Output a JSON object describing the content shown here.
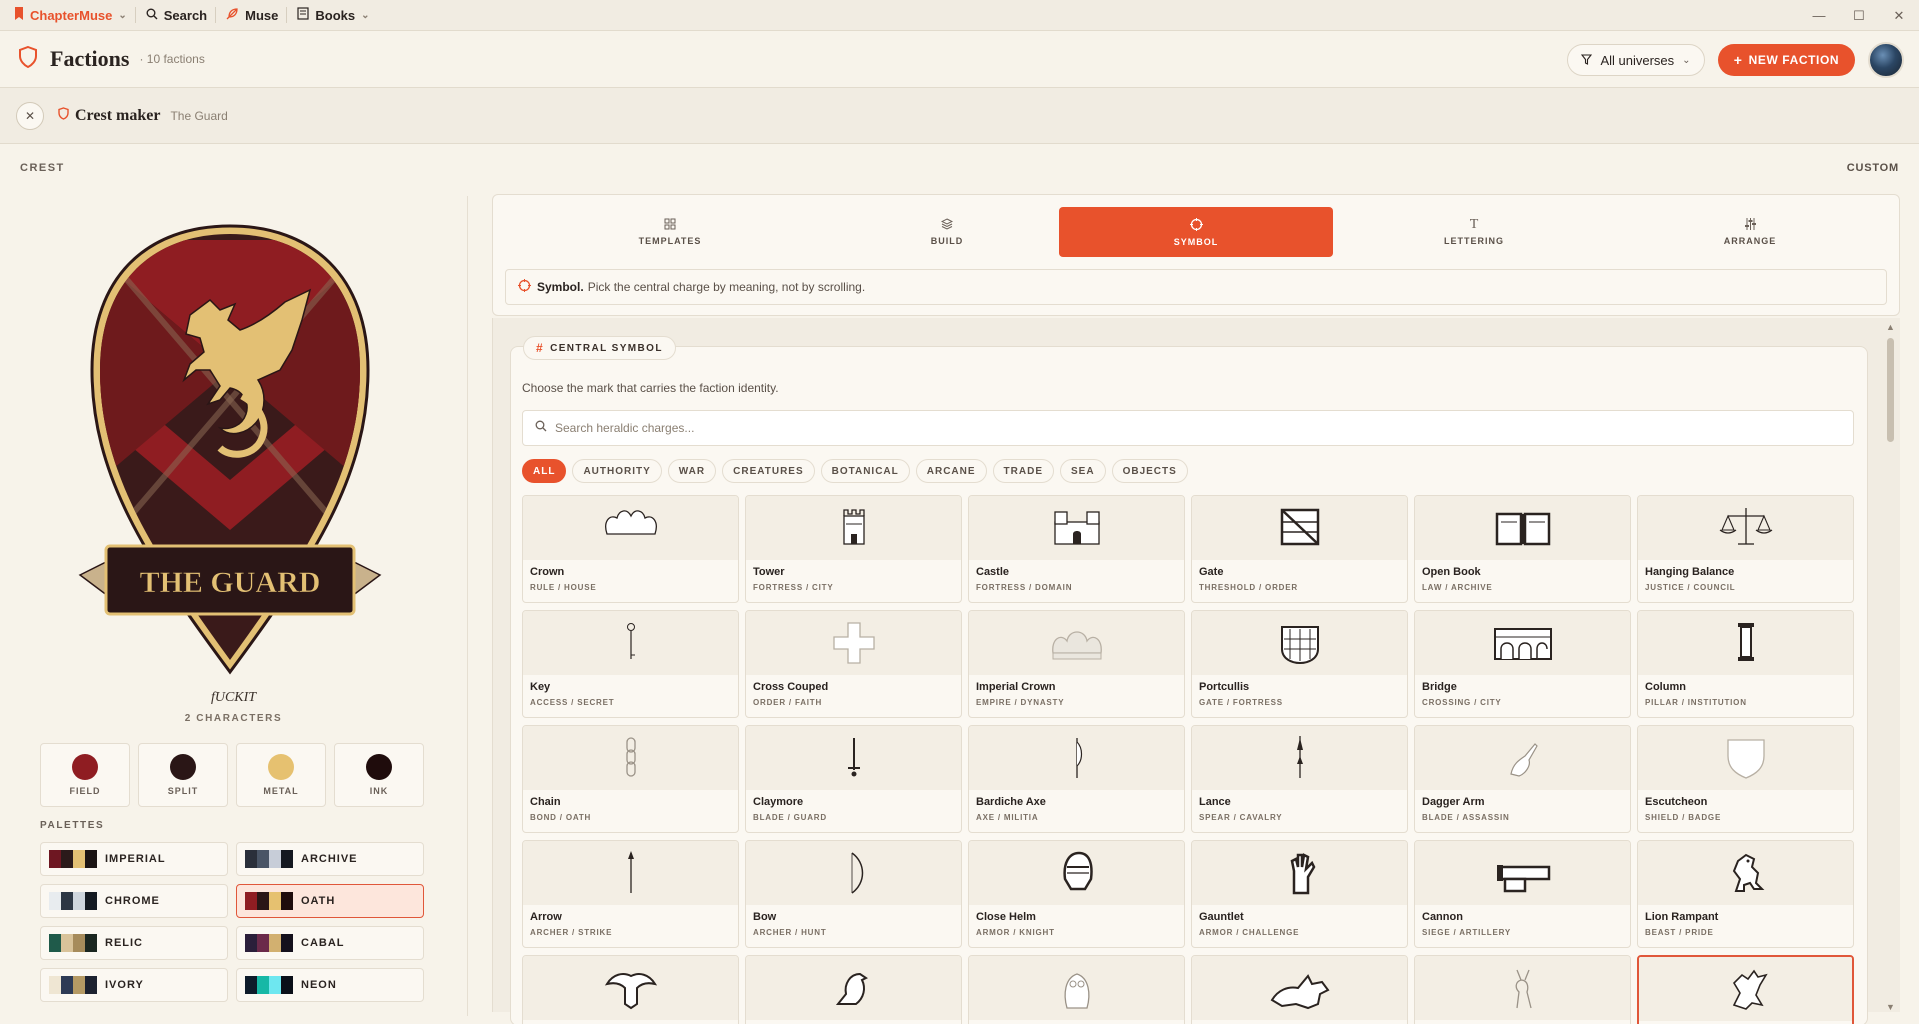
{
  "titlebar": {
    "brand": "ChapterMuse",
    "search": "Search",
    "muse": "Muse",
    "books": "Books"
  },
  "header": {
    "title": "Factions",
    "count": "· 10 factions",
    "filter": "All universes",
    "new_button": "NEW FACTION"
  },
  "subheader": {
    "title": "Crest maker",
    "context": "The Guard"
  },
  "crest_label": "CREST",
  "custom_label": "CUSTOM",
  "crest": {
    "banner_text": "THE GUARD",
    "motto": "fUCKIT",
    "characters": "2 CHARACTERS"
  },
  "swatches": [
    {
      "label": "FIELD",
      "color": "#8f1d22"
    },
    {
      "label": "SPLIT",
      "color": "#2a1616"
    },
    {
      "label": "METAL",
      "color": "#e6c170"
    },
    {
      "label": "INK",
      "color": "#1f0c0c"
    }
  ],
  "palettes_label": "PALETTES",
  "palettes": [
    {
      "name": "IMPERIAL",
      "colors": [
        "#6e1722",
        "#2b1a1a",
        "#e3c074",
        "#1b1414"
      ],
      "active": false
    },
    {
      "name": "ARCHIVE",
      "colors": [
        "#2a2f3a",
        "#4a5566",
        "#c7cdd8",
        "#141820"
      ],
      "active": false
    },
    {
      "name": "CHROME",
      "colors": [
        "#e8ecef",
        "#2d3744",
        "#cfd6dd",
        "#141a21"
      ],
      "active": false
    },
    {
      "name": "OATH",
      "colors": [
        "#8f1d22",
        "#2a1616",
        "#e6c170",
        "#1f0c0c"
      ],
      "active": true
    },
    {
      "name": "RELIC",
      "colors": [
        "#1f5a4a",
        "#d9c39a",
        "#a68b5b",
        "#1a2620"
      ],
      "active": false
    },
    {
      "name": "CABAL",
      "colors": [
        "#2b1f3a",
        "#6b2a4a",
        "#d2b070",
        "#14101c"
      ],
      "active": false
    },
    {
      "name": "IVORY",
      "colors": [
        "#efe6d3",
        "#2d3a55",
        "#b59a64",
        "#1d2230"
      ],
      "active": false
    },
    {
      "name": "NEON",
      "colors": [
        "#0e1b2a",
        "#17b8a6",
        "#6ee7f0",
        "#0a0f18"
      ],
      "active": false
    }
  ],
  "tabs": [
    {
      "label": "TEMPLATES",
      "icon": "grid-icon",
      "active": false
    },
    {
      "label": "BUILD",
      "icon": "layers-icon",
      "active": false
    },
    {
      "label": "SYMBOL",
      "icon": "crosshair-icon",
      "active": true
    },
    {
      "label": "LETTERING",
      "icon": "type-icon",
      "active": false
    },
    {
      "label": "ARRANGE",
      "icon": "sliders-icon",
      "active": false
    }
  ],
  "hint": {
    "strong": "Symbol.",
    "text": "Pick the central charge by meaning, not by scrolling."
  },
  "central_symbol": {
    "label": "CENTRAL SYMBOL",
    "description": "Choose the mark that carries the faction identity.",
    "search_placeholder": "Search heraldic charges...",
    "filters": [
      "ALL",
      "AUTHORITY",
      "WAR",
      "CREATURES",
      "BOTANICAL",
      "ARCANE",
      "TRADE",
      "SEA",
      "OBJECTS"
    ],
    "active_filter": "ALL"
  },
  "symbols": [
    {
      "name": "Crown",
      "tags": "RULE / HOUSE",
      "icon": "crown-icon"
    },
    {
      "name": "Tower",
      "tags": "FORTRESS / CITY",
      "icon": "tower-icon"
    },
    {
      "name": "Castle",
      "tags": "FORTRESS / DOMAIN",
      "icon": "castle-icon"
    },
    {
      "name": "Gate",
      "tags": "THRESHOLD / ORDER",
      "icon": "gate-icon"
    },
    {
      "name": "Open Book",
      "tags": "LAW / ARCHIVE",
      "icon": "book-icon"
    },
    {
      "name": "Hanging Balance",
      "tags": "JUSTICE / COUNCIL",
      "icon": "balance-icon"
    },
    {
      "name": "Key",
      "tags": "ACCESS / SECRET",
      "icon": "key-icon"
    },
    {
      "name": "Cross Couped",
      "tags": "ORDER / FAITH",
      "icon": "cross-icon"
    },
    {
      "name": "Imperial Crown",
      "tags": "EMPIRE / DYNASTY",
      "icon": "imperial-crown-icon"
    },
    {
      "name": "Portcullis",
      "tags": "GATE / FORTRESS",
      "icon": "portcullis-icon"
    },
    {
      "name": "Bridge",
      "tags": "CROSSING / CITY",
      "icon": "bridge-icon"
    },
    {
      "name": "Column",
      "tags": "PILLAR / INSTITUTION",
      "icon": "column-icon"
    },
    {
      "name": "Chain",
      "tags": "BOND / OATH",
      "icon": "chain-icon"
    },
    {
      "name": "Claymore",
      "tags": "BLADE / GUARD",
      "icon": "claymore-icon"
    },
    {
      "name": "Bardiche Axe",
      "tags": "AXE / MILITIA",
      "icon": "axe-icon"
    },
    {
      "name": "Lance",
      "tags": "SPEAR / CAVALRY",
      "icon": "lance-icon"
    },
    {
      "name": "Dagger Arm",
      "tags": "BLADE / ASSASSIN",
      "icon": "dagger-arm-icon"
    },
    {
      "name": "Escutcheon",
      "tags": "SHIELD / BADGE",
      "icon": "shield-icon"
    },
    {
      "name": "Arrow",
      "tags": "ARCHER / STRIKE",
      "icon": "arrow-icon"
    },
    {
      "name": "Bow",
      "tags": "ARCHER / HUNT",
      "icon": "bow-icon"
    },
    {
      "name": "Close Helm",
      "tags": "ARMOR / KNIGHT",
      "icon": "helm-icon"
    },
    {
      "name": "Gauntlet",
      "tags": "ARMOR / CHALLENGE",
      "icon": "gauntlet-icon"
    },
    {
      "name": "Cannon",
      "tags": "SIEGE / ARTILLERY",
      "icon": "cannon-icon"
    },
    {
      "name": "Lion Rampant",
      "tags": "BEAST / PRIDE",
      "icon": "lion-icon"
    },
    {
      "name": "",
      "tags": "",
      "icon": "eagle-icon"
    },
    {
      "name": "",
      "tags": "",
      "icon": "bird-icon"
    },
    {
      "name": "",
      "tags": "",
      "icon": "owl-icon"
    },
    {
      "name": "",
      "tags": "",
      "icon": "wolf-icon"
    },
    {
      "name": "",
      "tags": "",
      "icon": "stag-icon"
    },
    {
      "name": "",
      "tags": "",
      "icon": "dragon-icon",
      "selected": true
    }
  ],
  "colors": {
    "accent": "#e8522c",
    "background": "#f7f3ea"
  }
}
